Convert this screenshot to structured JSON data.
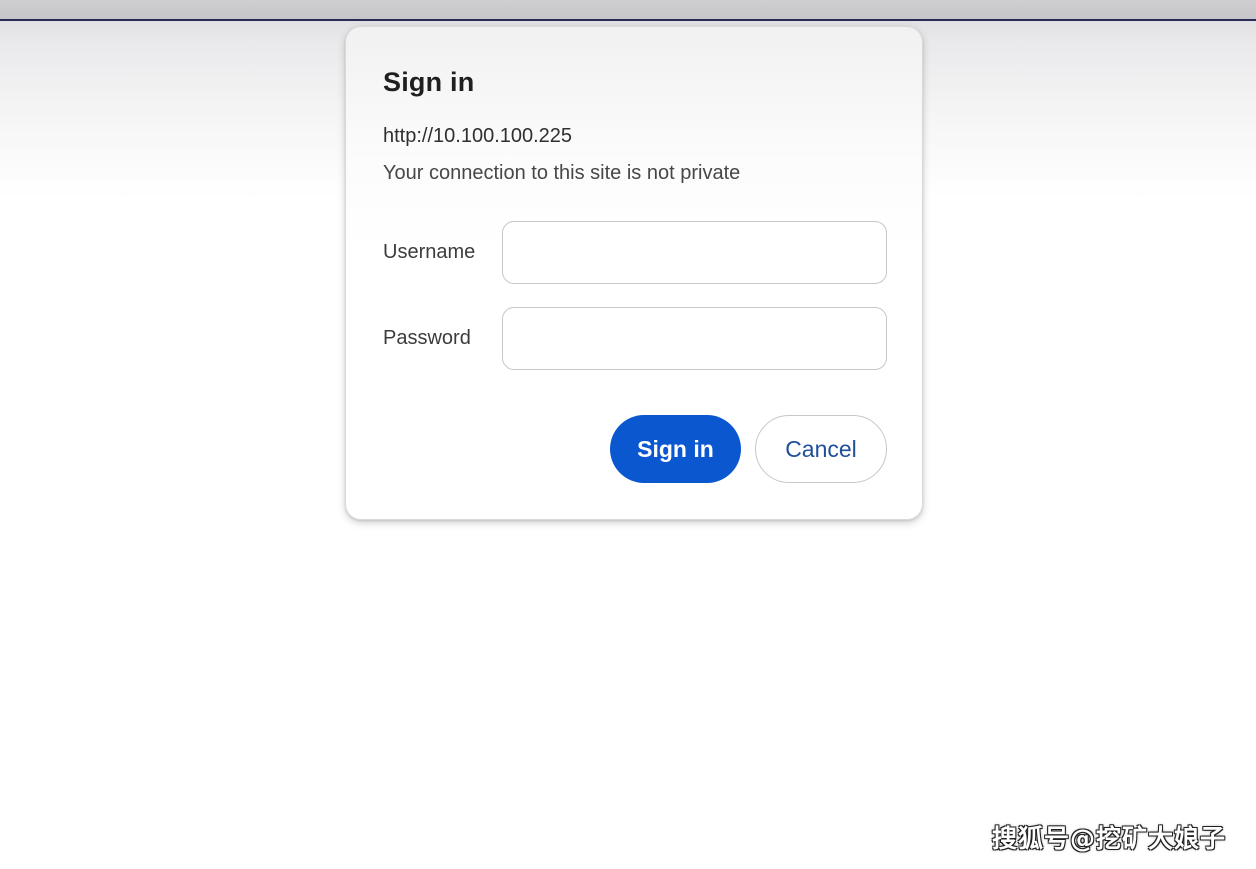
{
  "dialog": {
    "title": "Sign in",
    "url": "http://10.100.100.225",
    "warning": "Your connection to this site is not private",
    "username_label": "Username",
    "username_value": "",
    "password_label": "Password",
    "password_value": "",
    "sign_in_label": "Sign in",
    "cancel_label": "Cancel"
  },
  "watermark": "搜狐号@挖矿大娘子",
  "colors": {
    "primary_button": "#0b57d0",
    "cancel_text": "#1f4f9a",
    "browser_line": "#2a2a55"
  }
}
